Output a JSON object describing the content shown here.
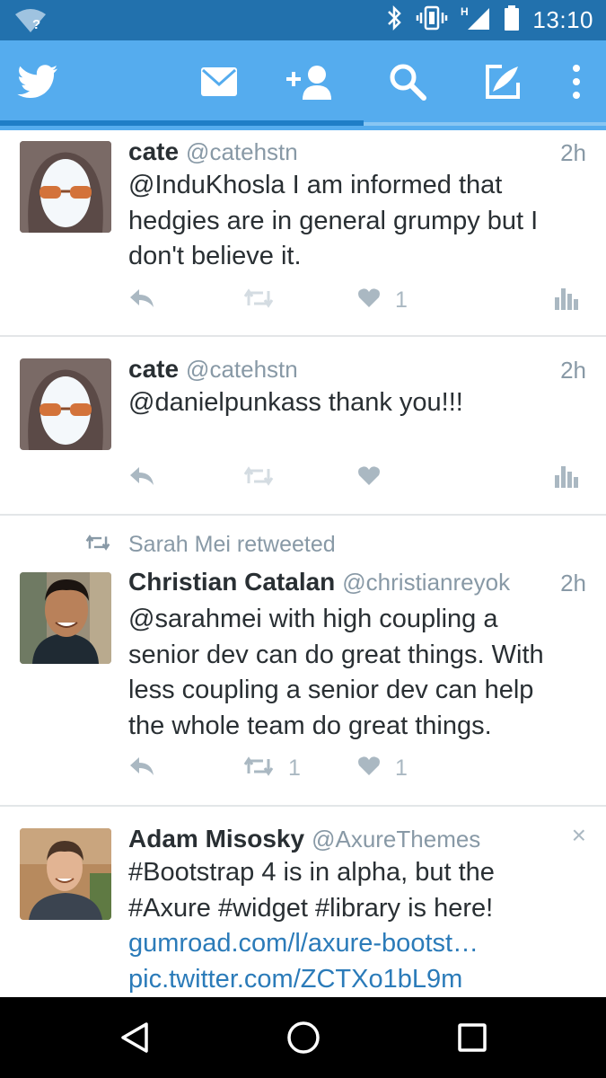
{
  "status_bar": {
    "time": "13:10",
    "wifi_badge": "?",
    "network_label": "H"
  },
  "app_bar": {
    "icons": [
      "twitter-logo-icon",
      "messages-icon",
      "add-user-icon",
      "search-icon",
      "compose-icon",
      "overflow-menu-icon"
    ],
    "active_tab_indicator": "home"
  },
  "timeline": {
    "tweets": [
      {
        "name": "cate",
        "handle": "@catehstn",
        "time": "2h",
        "text": "@InduKhosla I am informed that hedgies are in general grumpy but I don't believe it.",
        "retweet_count": "",
        "like_count": "1"
      },
      {
        "name": "cate",
        "handle": "@catehstn",
        "time": "2h",
        "text": "@danielpunkass thank you!!!",
        "retweet_count": "",
        "like_count": ""
      },
      {
        "retweeted_by": "Sarah Mei retweeted",
        "name": "Christian Catalan",
        "handle": "@christianreyok",
        "time": "2h",
        "text": "@sarahmei with high coupling a senior dev can do great things. With less coupling a senior dev can help the whole team do great things.",
        "retweet_count": "1",
        "like_count": "1"
      },
      {
        "name": "Adam Misosky",
        "handle": "@AxureThemes",
        "dismiss": "×",
        "text": "#Bootstrap 4 is in alpha, but the #Axure #widget #library is here!",
        "link1": "gumroad.com/l/axure-bootst…",
        "link2": "pic.twitter.com/ZCTXo1bL9m"
      }
    ]
  },
  "colors": {
    "status_bar": "#2271ad",
    "app_bar": "#55acee",
    "link": "#2b7bb9",
    "muted": "#8899a6",
    "action_icon": "#aab8c2"
  }
}
